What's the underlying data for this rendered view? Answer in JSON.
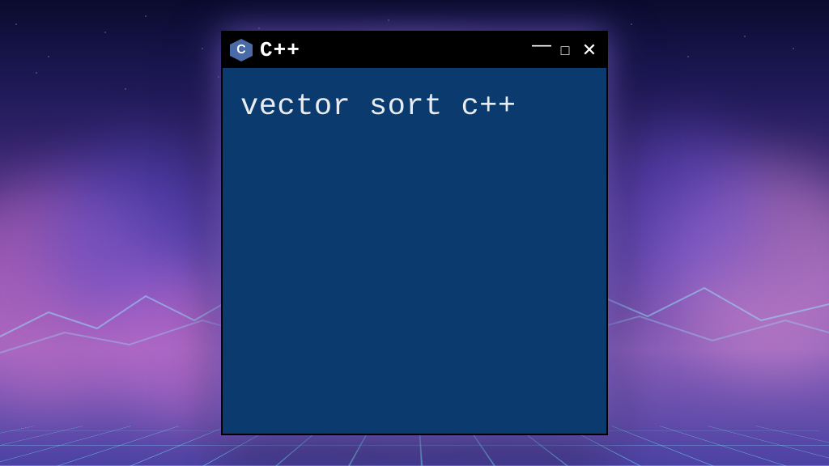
{
  "window": {
    "title": "C++",
    "icon_name": "cpp-icon"
  },
  "controls": {
    "minimize": "—",
    "maximize": "□",
    "close": "✕"
  },
  "content": {
    "text": "vector sort c++"
  },
  "colors": {
    "window_bg": "#0a3a6e",
    "titlebar_bg": "#000000",
    "text": "#e8ecf0",
    "glow": "#b496ff"
  }
}
